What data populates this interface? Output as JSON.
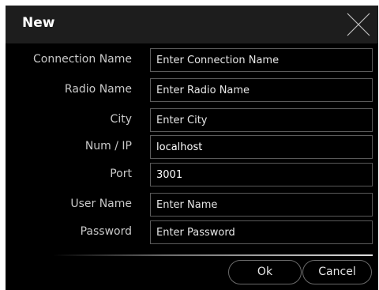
{
  "dialog": {
    "title": "New",
    "close_icon": "close-icon"
  },
  "form": {
    "fields": [
      {
        "label": "Connection Name",
        "value": "",
        "placeholder": "Enter Connection Name"
      },
      {
        "label": "Radio Name",
        "value": "",
        "placeholder": "Enter Radio Name"
      },
      {
        "label": "City",
        "value": "",
        "placeholder": "Enter City"
      },
      {
        "label": "Num / IP",
        "value": "localhost",
        "placeholder": ""
      },
      {
        "label": "Port",
        "value": "3001",
        "placeholder": ""
      },
      {
        "label": "User Name",
        "value": "",
        "placeholder": "Enter Name"
      },
      {
        "label": "Password",
        "value": "",
        "placeholder": "Enter Password"
      }
    ]
  },
  "buttons": {
    "ok_label": "Ok",
    "cancel_label": "Cancel"
  },
  "colors": {
    "background": "#000000",
    "title_bar": "#1d1d1d",
    "label_text": "#c9c9c9",
    "field_border": "#5a5a5a"
  }
}
